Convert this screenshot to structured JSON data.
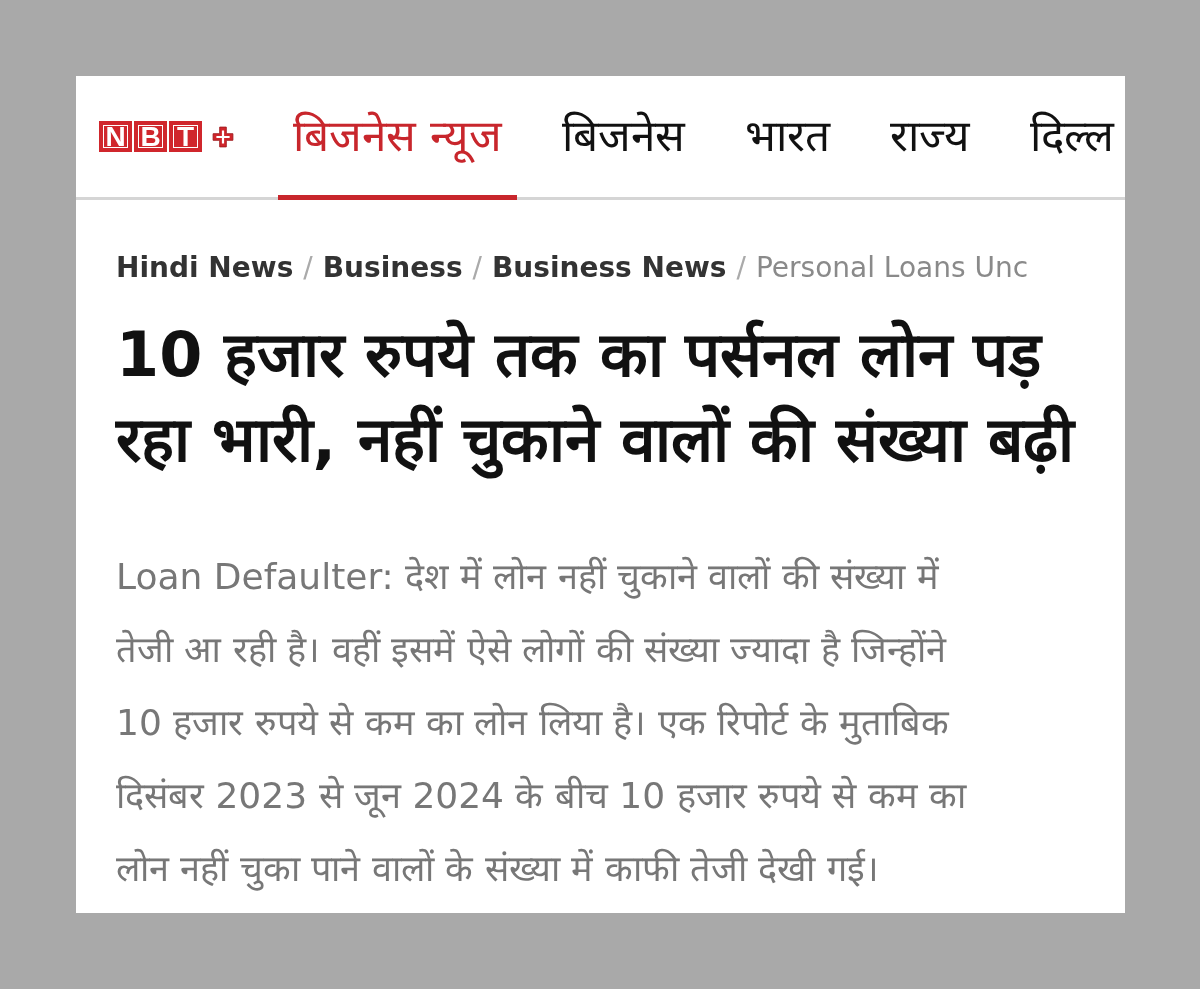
{
  "logo": {
    "letters": [
      "N",
      "B",
      "T"
    ]
  },
  "tabs": [
    {
      "label": "बिजनेस न्यूज",
      "selected": true
    },
    {
      "label": "बिजनेस",
      "selected": false
    },
    {
      "label": "भारत",
      "selected": false
    },
    {
      "label": "राज्य",
      "selected": false
    },
    {
      "label": "दिल्ल",
      "selected": false
    }
  ],
  "breadcrumb": [
    {
      "kind": "link",
      "text": "Hindi News"
    },
    {
      "kind": "separator",
      "text": "/"
    },
    {
      "kind": "link",
      "text": "Business"
    },
    {
      "kind": "separator",
      "text": "/"
    },
    {
      "kind": "link",
      "text": "Business News"
    },
    {
      "kind": "separator",
      "text": "/"
    },
    {
      "kind": "current",
      "text": "Personal Loans Unc"
    }
  ],
  "headline": "10 हजार रुपये तक का पर्सनल लोन पड़ रहा भारी, नहीं चुकाने वालों की संख्या बढ़ी",
  "summary": "Loan Defaulter: देश में लोन नहीं चुकाने वालों की संख्या में तेजी आ रही है। वहीं इसमें ऐसे लोगों की संख्या ज्यादा है जिन्होंने 10 हजार रुपये से कम का लोन लिया है। एक रिपोर्ट के मुताबिक दिसंबर 2023 से जून 2024 के बीच 10 हजार रुपये से कम का लोन नहीं चुका पाने वालों के संख्या में काफी तेजी देखी गई।"
}
